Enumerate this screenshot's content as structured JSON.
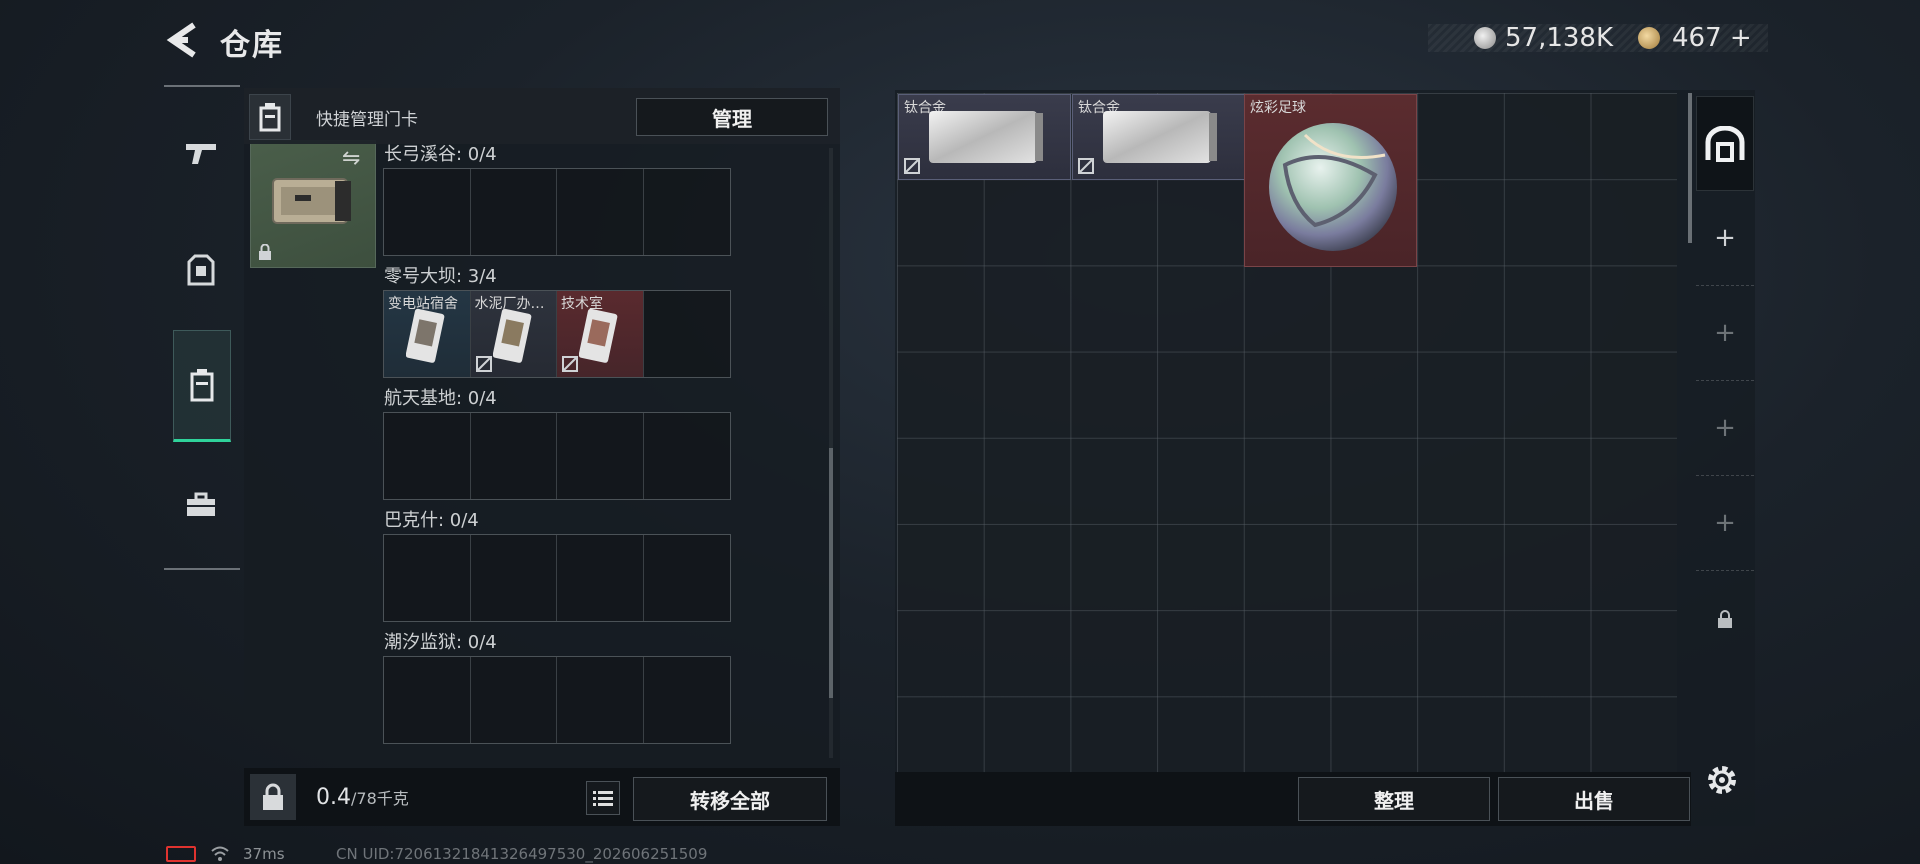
{
  "header": {
    "title": "仓库",
    "currency1_value": "57,138K",
    "currency2_value": "467",
    "currency2_plus": "+"
  },
  "rail": {
    "items": [
      {
        "icon": "pistol-icon"
      },
      {
        "icon": "armor-icon"
      },
      {
        "icon": "keycard-holder-icon",
        "active": true
      },
      {
        "icon": "toolbox-icon"
      }
    ]
  },
  "left_panel": {
    "header_label": "快捷管理门卡",
    "manage_label": "管理",
    "sections": [
      {
        "label": "长弓溪谷: 0/4",
        "slots": [
          "",
          "",
          "",
          ""
        ]
      },
      {
        "label": "零号大坝: 3/4",
        "slots": [
          "变电站宿舍",
          "水泥厂办…",
          "技术室",
          ""
        ]
      },
      {
        "label": "航天基地: 0/4",
        "slots": [
          "",
          "",
          "",
          ""
        ]
      },
      {
        "label": "巴克什: 0/4",
        "slots": [
          "",
          "",
          "",
          ""
        ]
      },
      {
        "label": "潮汐监狱: 0/4",
        "slots": [
          "",
          "",
          "",
          ""
        ]
      }
    ],
    "weight_value": "0.4",
    "weight_max": "/78千克",
    "transfer_all_label": "转移全部"
  },
  "stash": {
    "items": [
      {
        "name": "钛合金"
      },
      {
        "name": "钛合金"
      },
      {
        "name": "炫彩足球"
      }
    ],
    "sort_label": "整理",
    "sell_label": "出售"
  },
  "status": {
    "ping": "37ms",
    "uid": "CN UID:72061321841326497530_202606251509"
  },
  "colors": {
    "accent_green": "#2fd39b",
    "battery_red": "#e0332f",
    "rarity_red": "#5b2c2f",
    "rarity_blue": "#243644"
  }
}
